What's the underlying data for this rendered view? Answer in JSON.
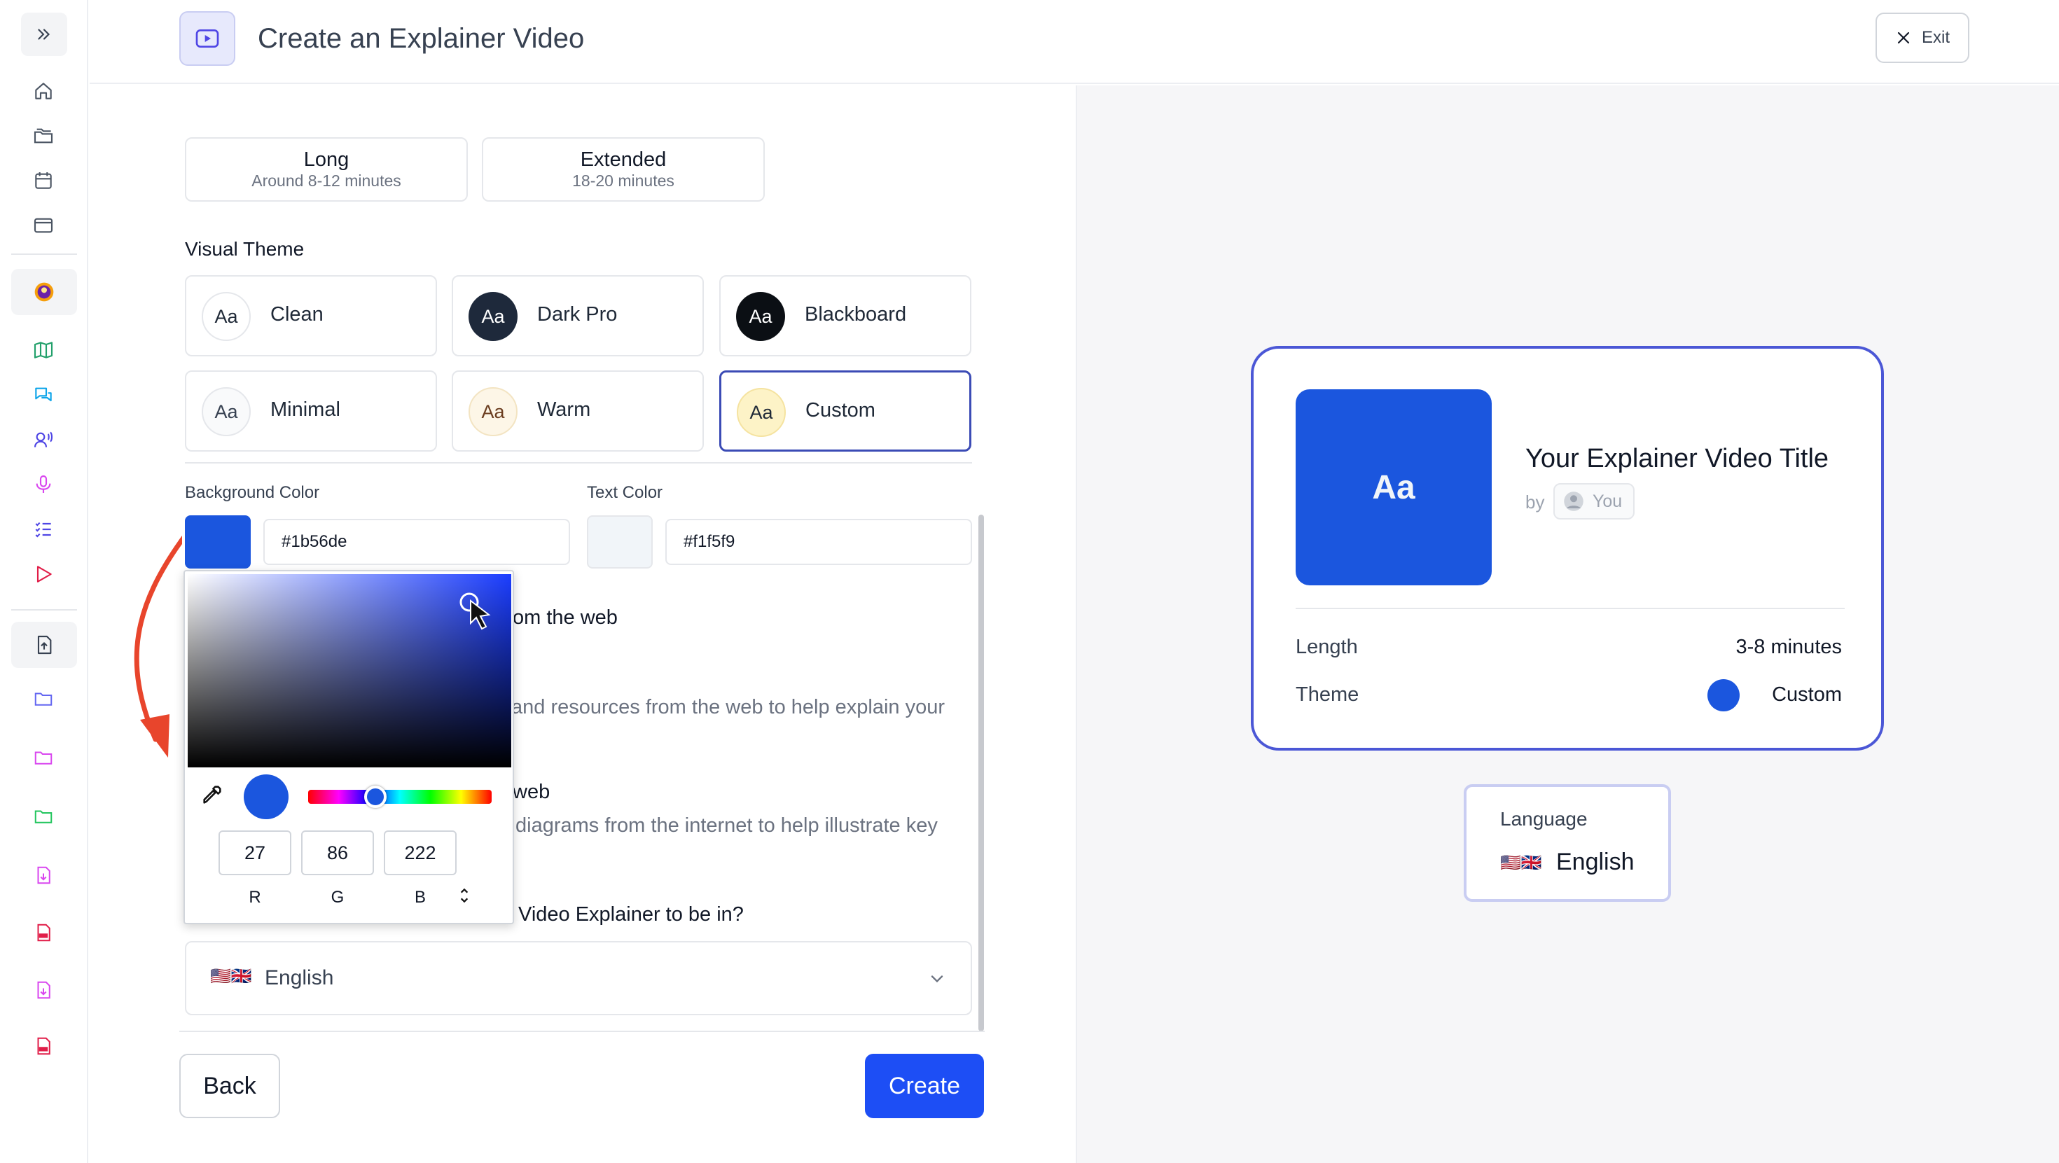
{
  "header": {
    "title": "Create an Explainer Video",
    "exit_label": "Exit"
  },
  "length_options": [
    {
      "title": "Long",
      "subtitle": "Around 8-12 minutes"
    },
    {
      "title": "Extended",
      "subtitle": "18-20 minutes"
    }
  ],
  "visual_theme": {
    "label": "Visual Theme",
    "badge_text": "Aa",
    "themes": [
      {
        "name": "Clean"
      },
      {
        "name": "Dark Pro"
      },
      {
        "name": "Blackboard"
      },
      {
        "name": "Minimal"
      },
      {
        "name": "Warm"
      },
      {
        "name": "Custom",
        "selected": true
      }
    ]
  },
  "colors": {
    "background_label": "Background Color",
    "background_value": "#1b56de",
    "text_label": "Text Color",
    "text_value": "#f1f5f9"
  },
  "picker": {
    "r": "27",
    "g": "86",
    "b": "222",
    "r_label": "R",
    "g_label": "G",
    "b_label": "B"
  },
  "obscured": {
    "web_title_fragment": "om the web",
    "web_desc_fragment": "and resources from the web to help explain your",
    "images_title_fragment": "web",
    "images_desc_fragment": "diagrams from the internet to help illustrate key",
    "language_question_fragment": "Video Explainer to be in?"
  },
  "language": {
    "flags": "🇺🇸🇬🇧",
    "value": "English",
    "label": "Language"
  },
  "buttons": {
    "back": "Back",
    "create": "Create"
  },
  "preview": {
    "thumb_text": "Aa",
    "title": "Your Explainer Video Title",
    "by": "by",
    "author": "You",
    "length_label": "Length",
    "length_value": "3-8 minutes",
    "theme_label": "Theme",
    "theme_value": "Custom",
    "theme_color": "#1b56de"
  },
  "accent": "#1d4ef5"
}
